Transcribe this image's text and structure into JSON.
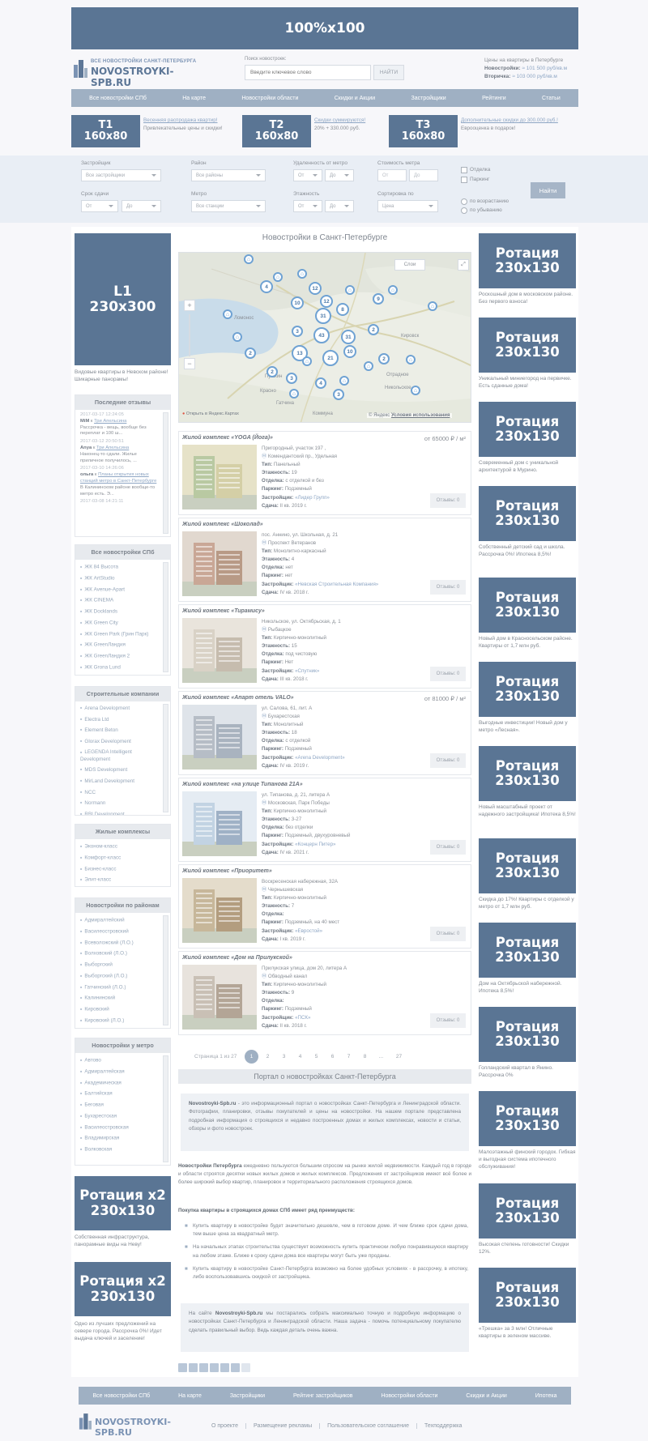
{
  "top_banner": "100%x100",
  "logo": {
    "line1": "ВСЕ НОВОСТРОЙКИ САНКТ-ПЕТЕРБУРГА",
    "line2": "NOVOSTROYKI-SPB.RU"
  },
  "search": {
    "label": "Поиск новостроек:",
    "placeholder": "Введите ключевое слово",
    "button": "НАЙТИ"
  },
  "prices": {
    "title": "Цены на квартиры в Петербурге",
    "new_label": "Новостройки:",
    "new_value": "≈ 101 500 руб/кв.м",
    "second_label": "Вторичка:",
    "second_value": "≈ 103 000 руб/кв.м"
  },
  "nav": [
    "Все новостройки СПб",
    "На карте",
    "Новостройки области",
    "Скидки и Акции",
    "Застройщики",
    "Рейтинги",
    "Статьи"
  ],
  "text_ads": [
    {
      "banner": "T1\n160x80",
      "link": "Весенняя распродажа квартир!",
      "text": "Привлекательные цены и скидки!"
    },
    {
      "banner": "T2\n160x80",
      "link": "Скидки суммируются!",
      "text": "20% + 330.000 руб."
    },
    {
      "banner": "T3\n160x80",
      "link": "Дополнительные скидки до 300.000 руб.!",
      "text": "Еврооценка в подарок!"
    }
  ],
  "filter": {
    "developers_label": "Застройщик",
    "developers_value": "Все застройщики",
    "district_label": "Район",
    "district_value": "Все районы",
    "distance_label": "Удаленность от метро",
    "distance_from": "От",
    "distance_to": "До",
    "cost_label": "Стоимость метра",
    "cost_from": "От",
    "cost_to": "До",
    "finish_label": "Отделка",
    "parking_label": "Паркинг",
    "term_label": "Срок сдачи",
    "term_from": "От",
    "term_to": "До",
    "metro_label": "Метро",
    "metro_value": "Все станции",
    "floors_label": "Этажность",
    "floors_from": "От",
    "floors_to": "До",
    "sort_label": "Сортировка по",
    "sort_value": "Цена",
    "asc_label": "по возрастанию",
    "desc_label": "по убыванию",
    "find_button": "Найти"
  },
  "left": {
    "l1_banner": "L1\n230x300",
    "l1_caption": "Видовые квартиры в Невском районе! Шикарные панорамы!",
    "reviews_title": "Последние отзывы",
    "reviews": [
      {
        "date": "2017-03-17 12:24:05",
        "user": "MiM",
        "verb": "к",
        "target": "Три Апельсина",
        "text": "Рассрочка - вещь, вообще без переплат и 100 ш..."
      },
      {
        "date": "2017-03-12 20:50:51",
        "user": "Anya",
        "verb": "к",
        "target": "Три Апельсина",
        "text": "Наконец-то сдали. Жилье приличное получилось, ..."
      },
      {
        "date": "2017-03-10 14:26:06",
        "user": "ольга",
        "verb": "к",
        "target": "Планы открытия новых станций метро в Санкт-Петербурге",
        "text": "В Калининском районе вообще-то метро есть. Э..."
      },
      {
        "date": "2017-03-08 14:21:11",
        "user": "",
        "verb": "",
        "target": "",
        "text": ""
      }
    ],
    "all_title": "Все новостройки СПб",
    "all_items": [
      "ЖК 84 Высота",
      "ЖК ArtStudio",
      "ЖК Avenue-Apart",
      "ЖК CINEMA",
      "ЖК Docklands",
      "ЖК Green City",
      "ЖК Green Park (Грин Парк)",
      "ЖК GreenЛандия",
      "ЖК GreenЛандия 2",
      "ЖК Grona Lund"
    ],
    "builders_title": "Строительные компании",
    "builders": [
      "Arena Development",
      "Electra Ltd",
      "Element Beton",
      "Glorax Development",
      "LEGENDA Intelligent Development",
      "MDS Development",
      "MirLand Development",
      "NCC",
      "Normann",
      "RBI Development"
    ],
    "complex_title": "Жилые комплексы",
    "complexes": [
      "Эконом-класс",
      "Комфорт-класс",
      "Бизнес-класс",
      "Элит-класс"
    ],
    "districts_title": "Новостройки по районам",
    "districts": [
      "Адмиралтейский",
      "Василеостровский",
      "Всеволожский (Л.О.)",
      "Волховский (Л.О.)",
      "Выборгский",
      "Выборгский (Л.О.)",
      "Гатчинский (Л.О.)",
      "Калининский",
      "Кировский",
      "Кировский (Л.О.)"
    ],
    "metro_title": "Новостройки у метро",
    "metro": [
      "Автово",
      "Адмиралтейская",
      "Академическая",
      "Балтийская",
      "Беговая",
      "Бухарестская",
      "Василеостровская",
      "Владимирская",
      "Волковская"
    ],
    "rot1": "Ротация x2\n230x130",
    "rot1_caption": "Собственная инфраструктура, панорамные виды на Неву!",
    "rot2": "Ротация x2\n230x130",
    "rot2_caption": "Одно из лучших предложений на севере города. Рассрочка 0%! Идет выдача ключей и заселение!"
  },
  "main_title": "Новостройки в Санкт-Петербурге",
  "map": {
    "layers": "Слои",
    "open_link": "Открыть в Яндекс.Картах",
    "copyright": "© Яндекс",
    "terms": "Условия использования",
    "labels": [
      "Ломонос",
      "Пушкин",
      "Красно",
      "Коммуна",
      "Отрадное",
      "Кировск",
      "Никольское",
      "Гатчина"
    ],
    "clusters": [
      "4",
      "12",
      "12",
      "8",
      "9",
      "10",
      "31",
      "3",
      "43",
      "31",
      "2",
      "2",
      "13",
      "21",
      "10",
      "2",
      "3",
      "4",
      "3",
      "2"
    ]
  },
  "listings": [
    {
      "title": "Жилой комплекс «YOGA (Йога)»",
      "price": "от 65000 ₽ / м²",
      "address": "Пригородный, участок 197 ,",
      "metro": "Комендантский пр., Удельная",
      "type": "Панельный",
      "floors": "19",
      "finish": "с отделкой и без",
      "parking": "Подземный",
      "developer": "«Лидер Групп»",
      "delivery": "II кв. 2019 г.",
      "reviews": "Отзывы: 0"
    },
    {
      "title": "Жилой комплекс «Шоколад»",
      "price": "",
      "address": "пос. Аннино, ул. Школьная, д. 21",
      "metro": "Проспект Ветеранов",
      "type": "Монолитно-каркасный",
      "floors": "4",
      "finish": "нет",
      "parking": "нет",
      "developer": "«Невская Строительная Компания»",
      "delivery": "IV кв. 2018 г.",
      "reviews": "Отзывы: 0"
    },
    {
      "title": "Жилой комплекс «Тирамису»",
      "price": "",
      "address": "Никольское, ул. Октябрьская, д. 1",
      "metro": "Рыбацкое",
      "type": "Кирпично-монолитный",
      "floors": "15",
      "finish": "под чистовую",
      "parking": "Нет",
      "developer": "«Спутник»",
      "delivery": "III кв. 2018 г.",
      "reviews": "Отзывы: 0"
    },
    {
      "title": "Жилой комплекс «Апарт отель VALO»",
      "price": "от 81000 ₽ / м²",
      "address": "ул. Салова, 61, лит. А",
      "metro": "Бухарестская",
      "type": "Монолитный",
      "floors": "18",
      "finish": "с отделкой",
      "parking": "Подземный",
      "developer": "«Arena Development»",
      "delivery": "IV кв. 2019 г.",
      "reviews": "Отзывы: 0"
    },
    {
      "title": "Жилой комплекс «на улице Типанова 21А»",
      "price": "",
      "address": "ул. Типанова, д. 21, литера А",
      "metro": "Московская, Парк Победы",
      "type": "Кирпично-монолитный",
      "floors": "3-27",
      "finish": "без отделки",
      "parking": "Подземный, двухуровневый",
      "developer": "«Концерн Питер»",
      "delivery": "IV кв. 2021 г.",
      "reviews": "Отзывы: 0"
    },
    {
      "title": "Жилой комплекс «Приоритет»",
      "price": "",
      "address": "Воскресенская набережная, 32А",
      "metro": "Чернышевская",
      "type": "Кирпично-монолитный",
      "floors": "7",
      "finish": "",
      "parking": "Подземный, на 40 мест",
      "developer": "«Евростой»",
      "delivery": "I кв. 2019 г.",
      "reviews": "Отзывы: 0"
    },
    {
      "title": "Жилой комплекс «Дом на Прилукской»",
      "price": "",
      "address": "Прилукская улица, дом 20, литера А",
      "metro": "Обводный канал",
      "type": "Кирпично-монолитный",
      "floors": "9",
      "finish": "",
      "parking": "Подземный",
      "developer": "«ПСК»",
      "delivery": "II кв. 2018 г.",
      "reviews": "Отзывы: 0"
    }
  ],
  "labels": {
    "type": "Тип:",
    "floors": "Этажность:",
    "finish": "Отделка:",
    "parking": "Паркинг:",
    "developer": "Застройщик:",
    "delivery": "Сдача:"
  },
  "pagination": {
    "info": "Страница 1 из 27",
    "pages": [
      "1",
      "2",
      "3",
      "4",
      "5",
      "6",
      "7",
      "8",
      "...",
      "27"
    ]
  },
  "portal": {
    "title": "Портал о новостройках Санкт-Петербурга",
    "intro_bold": "Novostroyki-Spb.ru",
    "intro": " - это информационный портал о новостройках Санкт-Петербурга и Ленинградской области. Фотографии, планировки, отзывы покупателей и цены на новостройки. На нашем портале представлена подробная информация о строящихся и недавно построенных домах и жилых комплексах, новости и статьи, обзоры и фото новостроек.",
    "p1_bold": "Новостройки Петербурга",
    "p1": " ежедневно пользуются большим спросом на рынке жилой недвижимости. Каждый год в городе и области строятся десятки новых жилых домов и жилых комплексов. Предложения от застройщиков имеют всё более и более широкий выбор квартир, планировок и территориального расположения строящихся домов.",
    "p2": "Покупка квартиры в строящихся домах СПб имеет ряд преимуществ:",
    "bullets": [
      "Купить квартиру в новостройке будет значительно дешевле, чем в готовом доме. И чем ближе срок сдачи дома, тем выше цена за квадратный метр.",
      "На начальных этапах строительства существует возможность купить практически любую понравившуюся квартиру на любом этаже. Ближе к сроку сдачи дома все квартиры могут быть уже проданы.",
      "Купить квартиру в новостройке Санкт-Петербурга возможно на более удобных условиях - в рассрочку, в ипотеку, либо воспользовавшись скидкой от застройщика."
    ],
    "outro_pre": "На сайте ",
    "outro_bold": "Novostroyki-Spb.ru",
    "outro": " мы постарались собрать максимально точную и подробную информацию о новостройках Санкт-Петербурга и Ленинградской области. Наша задача - помочь потенциальному покупателю сделать правильный выбор. Ведь каждая деталь очень важна."
  },
  "right": [
    {
      "banner": "Ротация\n230x130",
      "caption": "Роскошный дом в московском районе. Без первого взноса!"
    },
    {
      "banner": "Ротация\n230x130",
      "caption": "Уникальный миниегород на первичке. Есть сданные дома!"
    },
    {
      "banner": "Ротация\n230x130",
      "caption": "Современный дом с уникальной архитектурой в Мурино."
    },
    {
      "banner": "Ротация\n230x130",
      "caption": "Собственный детский сад и школа. Рассрочка 0%! Ипотека 8,5%!"
    },
    {
      "banner": "Ротация\n230x130",
      "caption": "Новый дом в Красносельском районе. Квартиры от 1,7 млн руб."
    },
    {
      "banner": "Ротация\n230x130",
      "caption": "Выгодные инвестиции! Новый дом у метро «Лесная»."
    },
    {
      "banner": "Ротация\n230x130",
      "caption": "Новый масштабный проект от надежного застройщика! Ипотека 8,5%!"
    },
    {
      "banner": "Ротация\n230x130",
      "caption": "Скидка до 17%! Квартиры с отделкой у метро от 1,7 млн руб."
    },
    {
      "banner": "Ротация\n230x130",
      "caption": "Дом на Октябрьской набережной. Ипотека 8,5%!"
    },
    {
      "banner": "Ротация\n230x130",
      "caption": "Голландский квартал в Янино. Рассрочка 0%"
    },
    {
      "banner": "Ротация\n230x130",
      "caption": "Малоэтажный финский городок. Гибкая и выгодная система ипотечного обслуживания!"
    },
    {
      "banner": "Ротация\n230x130",
      "caption": "Высокая степень готовности! Скидки 12%."
    },
    {
      "banner": "Ротация\n230x130",
      "caption": "«Трешка» за 3 млн! Отличные квартиры в зеленом массиве."
    }
  ],
  "footer_nav": [
    "Все новостройки СПб",
    "На карте",
    "Застройщики",
    "Рейтинг застройщиков",
    "Новостройки области",
    "Скидки и Акции",
    "Ипотека"
  ],
  "footer_logo": "NOVOSTROYKI-SPB.RU",
  "footer_links": [
    "О проекте",
    "Размещение рекламы",
    "Пользовательское соглашение",
    "Техподдержка"
  ]
}
